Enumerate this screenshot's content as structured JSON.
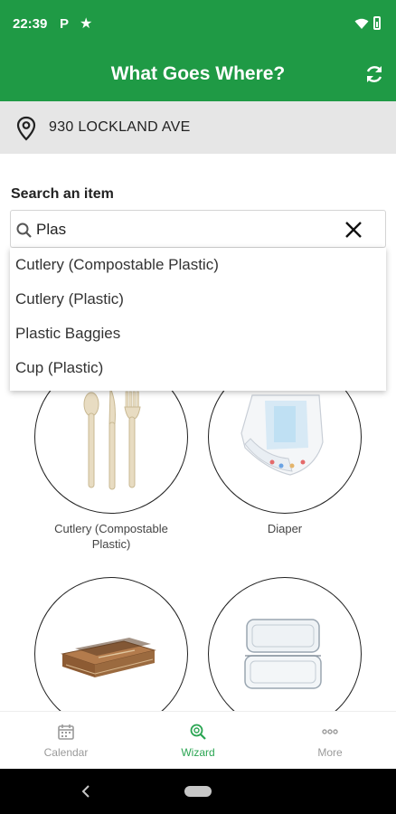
{
  "status_bar": {
    "time": "22:39",
    "parking_icon": "P",
    "star_icon": "star-icon"
  },
  "app_bar": {
    "title": "What Goes Where?",
    "refresh_icon": "refresh-icon"
  },
  "address": {
    "text": "930 LOCKLAND AVE",
    "icon": "location-pin-icon"
  },
  "search": {
    "label": "Search an item",
    "value": "Plas",
    "suggestions": [
      "Cutlery (Compostable Plastic)",
      "Cutlery (Plastic)",
      "Plastic Baggies",
      "Cup (Plastic)"
    ]
  },
  "grid": {
    "items": [
      {
        "caption": "Cutlery (Compostable Plastic)",
        "image": "compostable-cutlery-image"
      },
      {
        "caption": "Diaper",
        "image": "diaper-image"
      },
      {
        "caption": "",
        "image": "cardboard-image"
      },
      {
        "caption": "",
        "image": "plastic-container-image"
      }
    ]
  },
  "bottom_nav": {
    "items": [
      {
        "label": "Calendar",
        "icon": "calendar-icon"
      },
      {
        "label": "Wizard",
        "icon": "wizard-search-icon"
      },
      {
        "label": "More",
        "icon": "more-icon"
      }
    ],
    "active": "Wizard"
  },
  "colors": {
    "brand_green": "#1f9a45",
    "active_nav": "#2aa552",
    "inactive_nav": "#9a9a9a"
  }
}
